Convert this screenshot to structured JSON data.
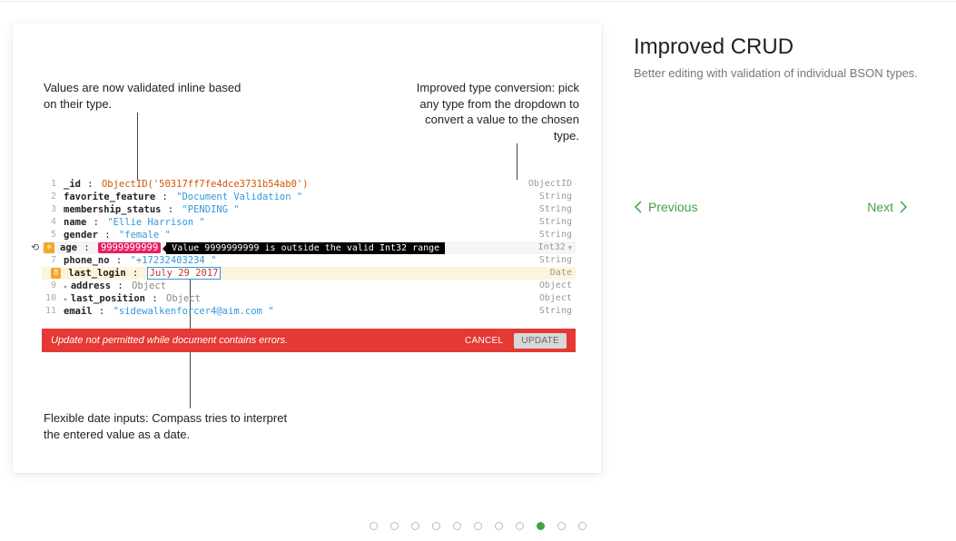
{
  "sidebar": {
    "title": "Improved CRUD",
    "subtitle": "Better editing with validation of individual BSON types.",
    "prev": "Previous",
    "next": "Next"
  },
  "annotations": {
    "a1": "Values are now validated inline based on their type.",
    "a2": "Improved type conversion: pick any type from the dropdown to convert a value to the chosen type.",
    "a3": "Flexible date inputs: Compass tries to interpret the entered value as a date."
  },
  "tooltip": "Value 9999999999 is outside the valid Int32 range",
  "errorbar": {
    "msg": "Update not permitted while document contains errors.",
    "cancel": "CANCEL",
    "update": "UPDATE"
  },
  "rows": [
    {
      "n": "1",
      "key": "_id",
      "val": "ObjectID('50317ff7fe4dce3731b54ab0')",
      "valClass": "val-objectid",
      "type": "ObjectID"
    },
    {
      "n": "2",
      "key": "favorite_feature",
      "val": "\"Document Validation \"",
      "valClass": "val-string",
      "type": "String"
    },
    {
      "n": "3",
      "key": "membership_status",
      "val": "\"PENDING \"",
      "valClass": "val-string",
      "type": "String"
    },
    {
      "n": "4",
      "key": "name",
      "val": "\"Ellie Harrison \"",
      "valClass": "val-string",
      "type": "String"
    },
    {
      "n": "5",
      "key": "gender",
      "val": "\"female \"",
      "valClass": "val-string",
      "type": "String"
    },
    {
      "n": "+",
      "key": "age",
      "val": "9999999999",
      "valClass": "val-pink",
      "type": "Int32",
      "hasTooltip": true,
      "rowClass": "highlight-age",
      "orangeNum": true,
      "undo": true
    },
    {
      "n": "7",
      "key": "phone_no",
      "val": "\"+17232403234 \"",
      "valClass": "val-string",
      "type": "String"
    },
    {
      "n": "8",
      "key": "last_login",
      "val": "July 29 2017",
      "valClass": "val-redbox",
      "type": "Date",
      "rowClass": "highlight-login",
      "orangeNum": true
    },
    {
      "n": "9",
      "key": "address",
      "val": "Object",
      "valClass": "val-obj",
      "type": "Object",
      "expand": true
    },
    {
      "n": "10",
      "key": "last_position",
      "val": "Object",
      "valClass": "val-obj",
      "type": "Object",
      "expand": true
    },
    {
      "n": "11",
      "key": "email",
      "val": "\"sidewalkenforcer4@aim.com \"",
      "valClass": "val-string",
      "type": "String"
    }
  ],
  "pager": {
    "total": 11,
    "active": 8
  }
}
